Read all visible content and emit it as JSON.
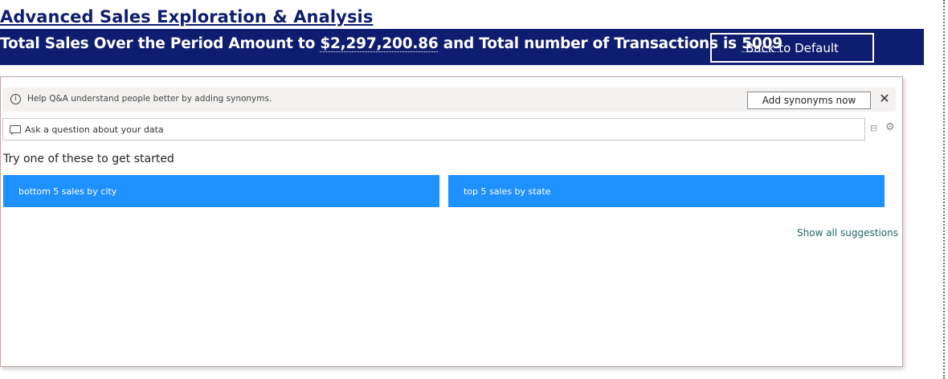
{
  "page": {
    "title": "Advanced Sales Exploration & Analysis"
  },
  "banner": {
    "prefix": "Total Sales Over the Period Amount to ",
    "total_sales": "$2,297,200.86",
    "middle": " and Total number of Transactions is ",
    "transactions": "5009",
    "back_button_label": "Back to Default",
    "color": "#0f1d70"
  },
  "qna": {
    "info_text": "Help Q&A understand people better by adding synonyms.",
    "add_synonyms_label": "Add synonyms now",
    "close_glyph": "✕",
    "question_placeholder": "Ask a question about your data",
    "try_heading": "Try one of these to get started",
    "suggestions": [
      "bottom 5 sales by city",
      "top 5 sales by state"
    ],
    "show_all_label": "Show all suggestions",
    "accent_color": "#1e90ff",
    "icons": [
      "info-icon",
      "close-icon",
      "chat-icon",
      "tree-icon",
      "gear-icon"
    ]
  }
}
